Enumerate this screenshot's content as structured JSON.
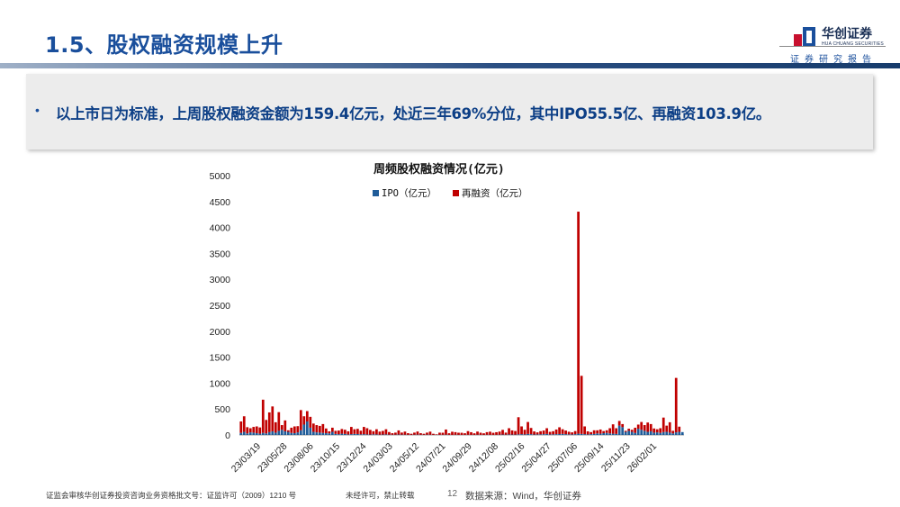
{
  "header": {
    "title": "1.5、股权融资规模上升",
    "logo_name": "华创证券",
    "logo_sub": "HUA CHUANG SECURITIES",
    "report_label": "证券研究报告"
  },
  "callout": {
    "bullet": "•",
    "text": "以上市日为标准，上周股权融资金额为159.4亿元，处近三年69%分位，其中IPO55.5亿、再融资103.9亿。"
  },
  "footer": {
    "license": "证监会审核华创证券投资咨询业务资格批文号：证监许可（2009）1210 号",
    "notice": "未经许可，禁止转载",
    "page": "12",
    "source": "数据来源：Wind，华创证券"
  },
  "colors": {
    "ipo": "#1f5c99",
    "refi": "#c00000",
    "title": "#1a4f9c"
  },
  "chart_data": {
    "type": "bar",
    "stacked": true,
    "title": "周频股权融资情况(亿元)",
    "ylim": [
      0,
      5000
    ],
    "yticks": [
      0,
      500,
      1000,
      1500,
      2000,
      2500,
      3000,
      3500,
      4000,
      4500,
      5000
    ],
    "xtick_labels": [
      "23/03/19",
      "23/05/28",
      "23/08/06",
      "23/10/15",
      "23/12/24",
      "24/03/03",
      "24/05/12",
      "24/07/21",
      "24/09/29",
      "24/12/08",
      "25/02/16",
      "25/04/27",
      "25/07/06",
      "25/09/14",
      "25/11/23",
      "26/02/01"
    ],
    "legend_position": "top",
    "series": [
      {
        "name": "IPO（亿元）",
        "key": "ipo",
        "values": [
          40,
          60,
          30,
          50,
          45,
          35,
          25,
          40,
          30,
          55,
          70,
          45,
          80,
          100,
          70,
          60,
          40,
          35,
          50,
          90,
          200,
          260,
          140,
          60,
          50,
          45,
          40,
          35,
          30,
          60,
          20,
          15,
          25,
          20,
          10,
          15,
          20,
          18,
          12,
          15,
          10,
          8,
          12,
          10,
          5,
          8,
          10,
          6,
          4,
          5,
          8,
          6,
          5,
          4,
          3,
          5,
          6,
          4,
          3,
          5,
          4,
          3,
          2,
          4,
          3,
          5,
          3,
          2,
          4,
          3,
          2,
          3,
          4,
          3,
          2,
          5,
          3,
          2,
          4,
          3,
          2,
          3,
          5,
          8,
          5,
          10,
          8,
          6,
          12,
          15,
          10,
          20,
          15,
          8,
          10,
          12,
          15,
          20,
          10,
          12,
          15,
          18,
          20,
          15,
          12,
          10,
          15,
          25,
          20,
          15,
          10,
          15,
          20,
          30,
          25,
          35,
          40,
          30,
          25,
          20,
          180,
          150,
          60,
          80,
          60,
          40,
          120,
          100,
          80,
          60,
          70,
          45,
          50,
          40,
          55,
          60,
          45,
          30,
          50,
          60,
          55
        ]
      },
      {
        "name": "再融资（亿元）",
        "key": "refi",
        "values": [
          220,
          300,
          120,
          80,
          110,
          130,
          120,
          640,
          260,
          380,
          480,
          200,
          360,
          90,
          210,
          30,
          100,
          130,
          120,
          390,
          160,
          200,
          210,
          160,
          140,
          130,
          170,
          90,
          40,
          80,
          60,
          70,
          90,
          80,
          60,
          140,
          90,
          100,
          70,
          140,
          120,
          90,
          60,
          100,
          60,
          70,
          100,
          50,
          30,
          40,
          80,
          40,
          60,
          30,
          20,
          40,
          60,
          30,
          20,
          40,
          60,
          20,
          10,
          40,
          40,
          100,
          30,
          60,
          50,
          40,
          40,
          30,
          70,
          50,
          30,
          60,
          40,
          30,
          50,
          60,
          40,
          50,
          60,
          90,
          40,
          120,
          80,
          70,
          330,
          150,
          90,
          230,
          120,
          60,
          40,
          60,
          70,
          110,
          50,
          60,
          90,
          130,
          90,
          70,
          50,
          40,
          60,
          4280,
          1120,
          150,
          60,
          40,
          70,
          60,
          80,
          40,
          50,
          100,
          180,
          110,
          90,
          60,
          20,
          40,
          40,
          100,
          80,
          150,
          110,
          180,
          140,
          80,
          60,
          90,
          280,
          120,
          200,
          50,
          1050,
          100
        ]
      }
    ]
  }
}
